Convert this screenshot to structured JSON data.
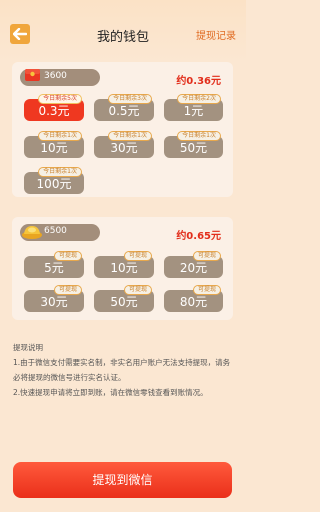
{
  "header": {
    "title": "我的钱包",
    "record_link": "提现记录"
  },
  "card_red_packet": {
    "coin_amount": "3600",
    "approx_value": "约0.36元",
    "options": [
      {
        "label": "0.3元",
        "tag": "今日剩余5次",
        "selected": true
      },
      {
        "label": "0.5元",
        "tag": "今日剩余3次",
        "selected": false
      },
      {
        "label": "1元",
        "tag": "今日剩余2次",
        "selected": false
      },
      {
        "label": "10元",
        "tag": "今日剩余1次",
        "selected": false
      },
      {
        "label": "30元",
        "tag": "今日剩余1次",
        "selected": false
      },
      {
        "label": "50元",
        "tag": "今日剩余1次",
        "selected": false
      },
      {
        "label": "100元",
        "tag": "今日剩余1次",
        "selected": false
      }
    ]
  },
  "card_gold": {
    "coin_amount": "6500",
    "approx_value": "约0.65元",
    "options": [
      {
        "label": "5元",
        "tag": "可提现"
      },
      {
        "label": "10元",
        "tag": "可提现"
      },
      {
        "label": "20元",
        "tag": "可提现"
      },
      {
        "label": "30元",
        "tag": "可提现"
      },
      {
        "label": "50元",
        "tag": "可提现"
      },
      {
        "label": "80元",
        "tag": "可提现"
      }
    ]
  },
  "notes": {
    "title": "提现说明",
    "line1": "1.由于微信支付需要实名制，非实名用户账户无法支持提现，请务必将提现的微信号进行实名认证。",
    "line2": "2.快速提现申请将立即到账，请在微信零钱查看到账情况。"
  },
  "primary_action": {
    "label": "提现到微信"
  },
  "colors": {
    "accent": "#ef3820",
    "inactive_option": "#a39280",
    "background": "#fbe7d2"
  },
  "icons": {
    "back": "left-arrow-icon",
    "red_packet": "red-packet-icon",
    "gold": "gold-ingot-icon"
  }
}
